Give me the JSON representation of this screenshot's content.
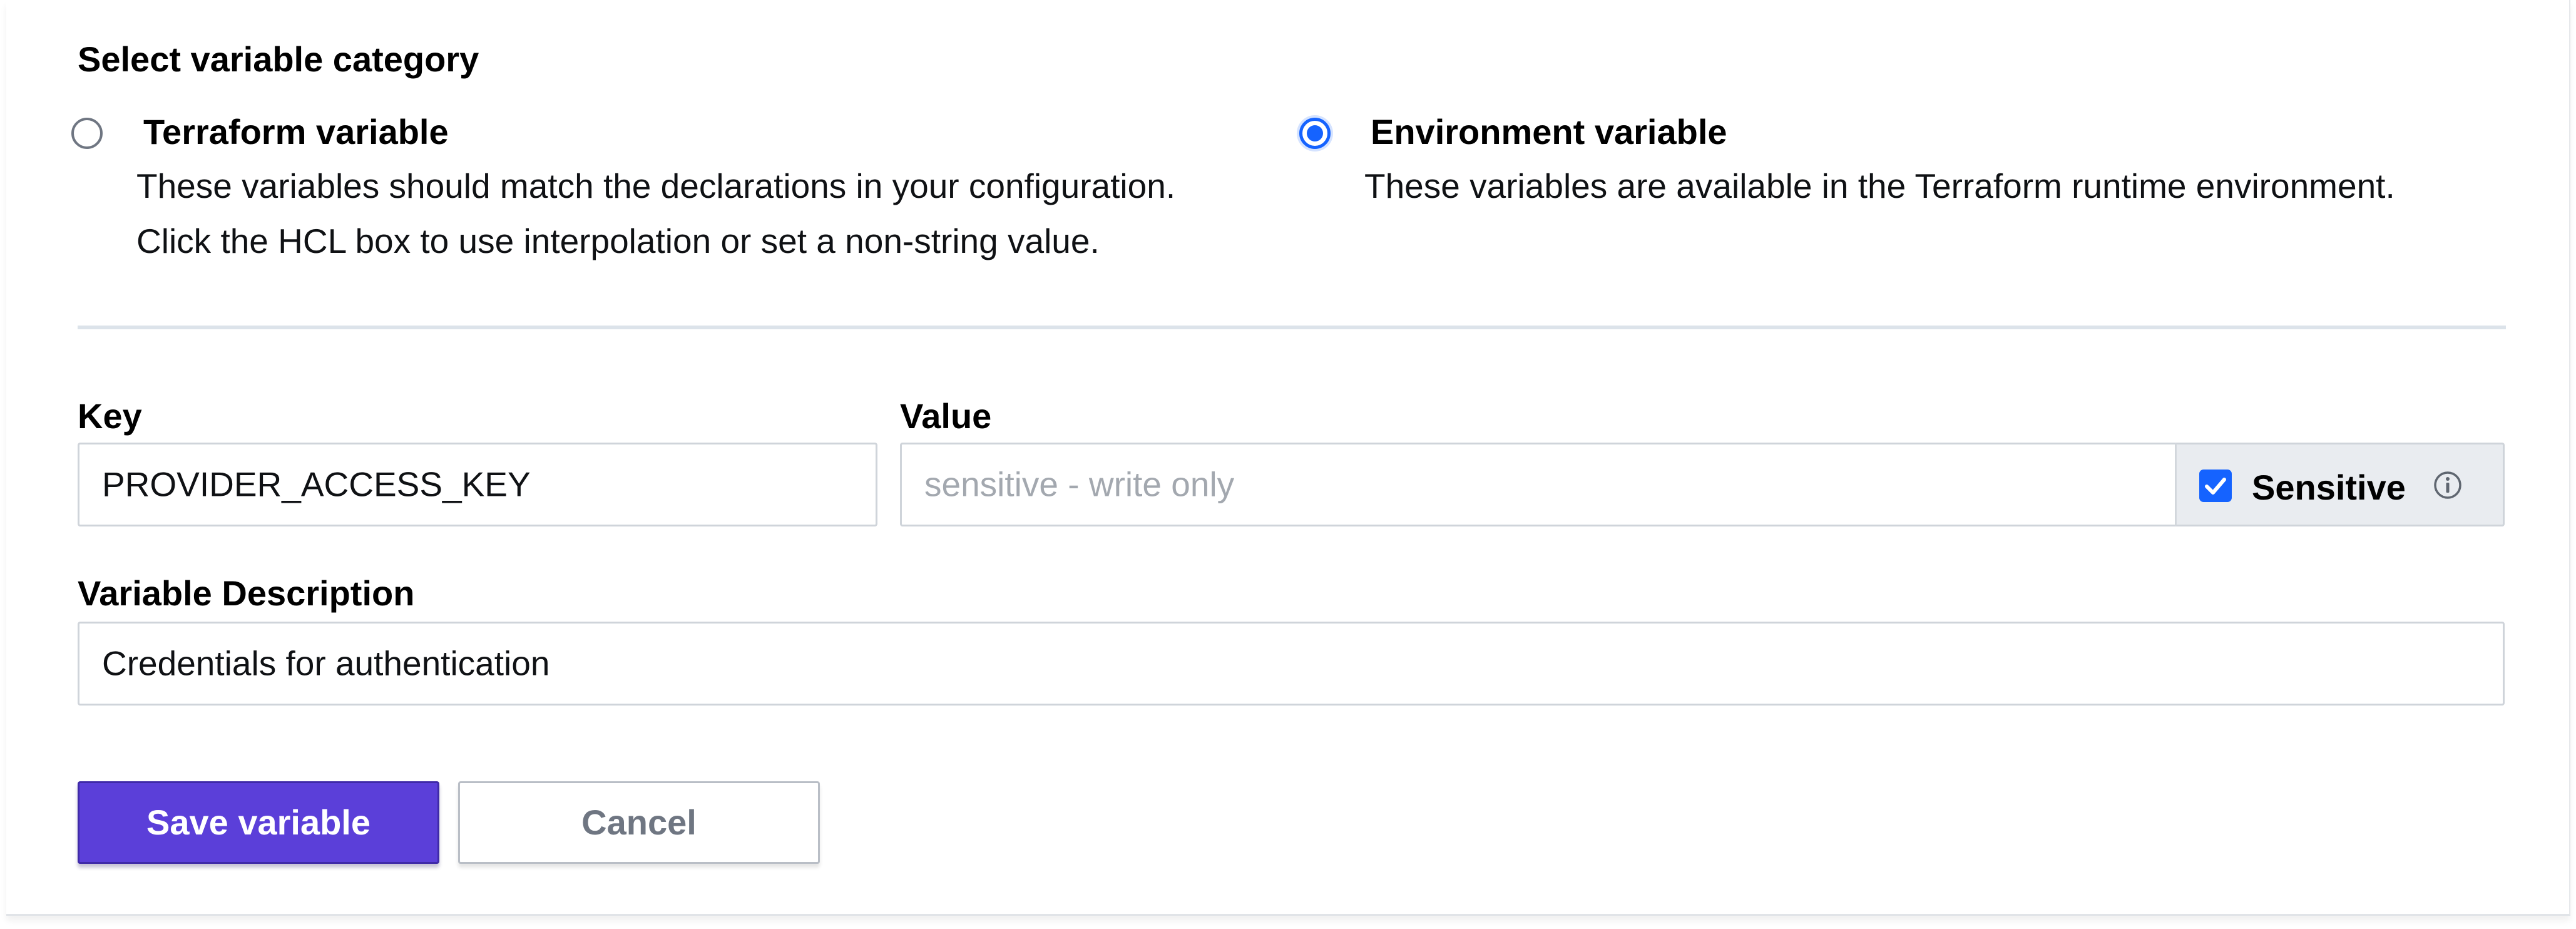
{
  "form": {
    "category_title": "Select variable category",
    "options": [
      {
        "title": "Terraform variable",
        "selected": false,
        "description_lines": [
          "These variables should match the declarations in your configuration.",
          "Click the HCL box to use interpolation or set a non-string value."
        ]
      },
      {
        "title": "Environment variable",
        "selected": true,
        "description_lines": [
          "These variables are available in the Terraform runtime environment."
        ]
      }
    ],
    "key": {
      "label": "Key",
      "value": "PROVIDER_ACCESS_KEY"
    },
    "value": {
      "label": "Value",
      "placeholder": "sensitive - write only"
    },
    "sensitive": {
      "label": "Sensitive",
      "checked": true,
      "icon": "info-icon"
    },
    "description": {
      "label": "Variable Description",
      "value": "Credentials for authentication"
    },
    "buttons": {
      "save": "Save variable",
      "cancel": "Cancel"
    }
  },
  "colors": {
    "primary_button": "#5b3fd9",
    "radio_accent": "#1563ff",
    "divider": "#dce3ea",
    "sensitive_bg": "#e9ecf0"
  }
}
